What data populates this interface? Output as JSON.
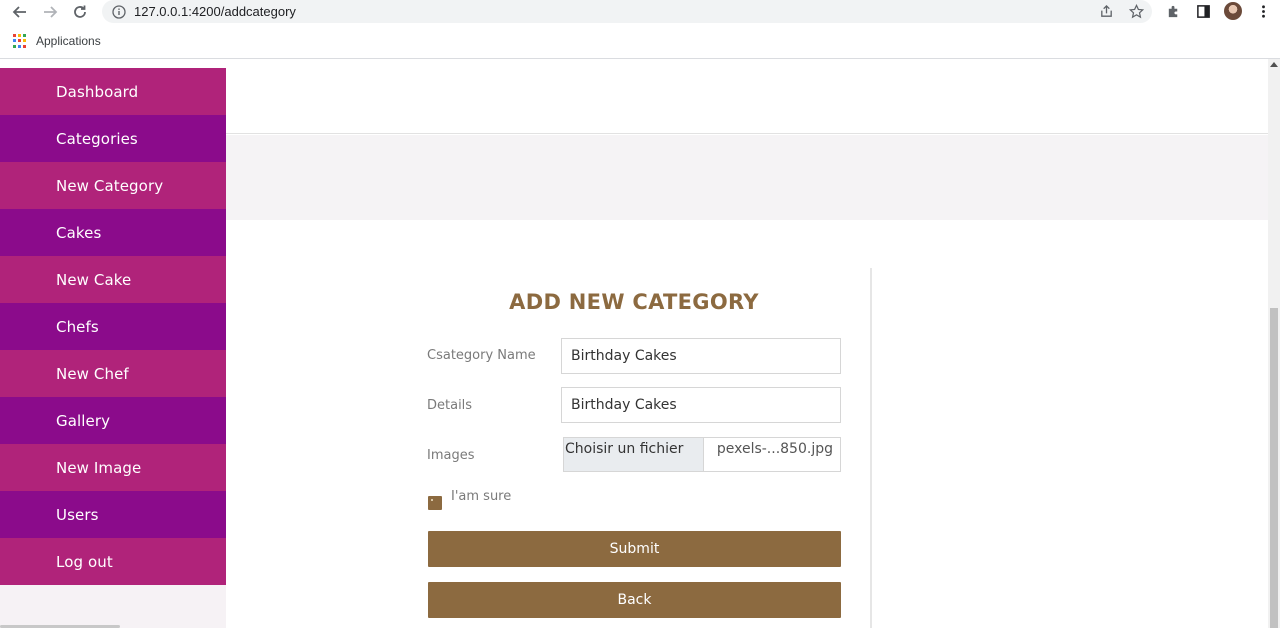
{
  "browser": {
    "url": "127.0.0.1:4200/addcategory",
    "bookmarks_label": "Applications"
  },
  "icons": {
    "back": "arrow-left-icon",
    "forward": "arrow-right-icon",
    "reload": "reload-icon",
    "info": "info-icon",
    "share": "share-icon",
    "bookmark": "star-icon",
    "extensions": "puzzle-icon",
    "sidepanel": "sidepanel-icon",
    "profile": "avatar",
    "menu": "more-vertical-icon",
    "apps": "apps-grid-icon"
  },
  "colors": {
    "sidebar_pink": "#b0237a",
    "sidebar_purple": "#8b0b8b",
    "accent_brown": "#8c6a40"
  },
  "sidebar": {
    "items": [
      {
        "label": "Dashboard"
      },
      {
        "label": "Categories"
      },
      {
        "label": "New Category"
      },
      {
        "label": "Cakes"
      },
      {
        "label": "New Cake"
      },
      {
        "label": "Chefs"
      },
      {
        "label": "New Chef"
      },
      {
        "label": "Gallery"
      },
      {
        "label": "New Image"
      },
      {
        "label": "Users"
      },
      {
        "label": "Log out"
      }
    ]
  },
  "form": {
    "title": "ADD NEW CATEGORY",
    "name_label": "Csategory Name",
    "name_value": "Birthday Cakes",
    "details_label": "Details",
    "details_value": "Birthday Cakes",
    "images_label": "Images",
    "file_button": "Choisir un fichier",
    "file_name": "pexels-...850.jpg",
    "checkbox_label": "I'am sure",
    "checkbox_checked": true,
    "submit_label": "Submit",
    "back_label": "Back"
  }
}
